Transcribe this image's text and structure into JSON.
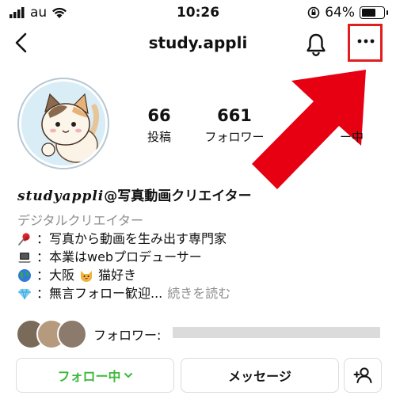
{
  "status_bar": {
    "carrier": "au",
    "time": "10:26",
    "battery": "64%",
    "battery_level": 0.64
  },
  "nav": {
    "username": "study.appli"
  },
  "profile": {
    "stats": [
      {
        "value": "66",
        "label": "投稿"
      },
      {
        "value": "661",
        "label": "フォロワー"
      },
      {
        "value": "",
        "label": "ー中"
      }
    ]
  },
  "bio": {
    "name_script": "studyappli",
    "name_suffix": "@写真動画クリエイター",
    "category": "デジタルクリエイター",
    "lines": [
      {
        "icon": "pushpin-icon",
        "text": "：写真から動画を生み出す専門家"
      },
      {
        "icon": "laptop-icon",
        "text": "：本業はwebプロデューサー"
      },
      {
        "icon": "globe-icon",
        "text_a": "：大阪 ",
        "icon2": "cat-face-icon",
        "text_b": " 猫好き"
      },
      {
        "icon": "gem-icon",
        "text": "：無言フォロー歓迎...",
        "more": "続きを読む"
      }
    ]
  },
  "followers_row": {
    "label": "フォロワー:"
  },
  "buttons": {
    "follow": "フォロー中",
    "message": "メッセージ"
  },
  "colors": {
    "highlight": "#e01e1e",
    "following_green": "#3db83a",
    "arrow_red": "#e60012"
  }
}
